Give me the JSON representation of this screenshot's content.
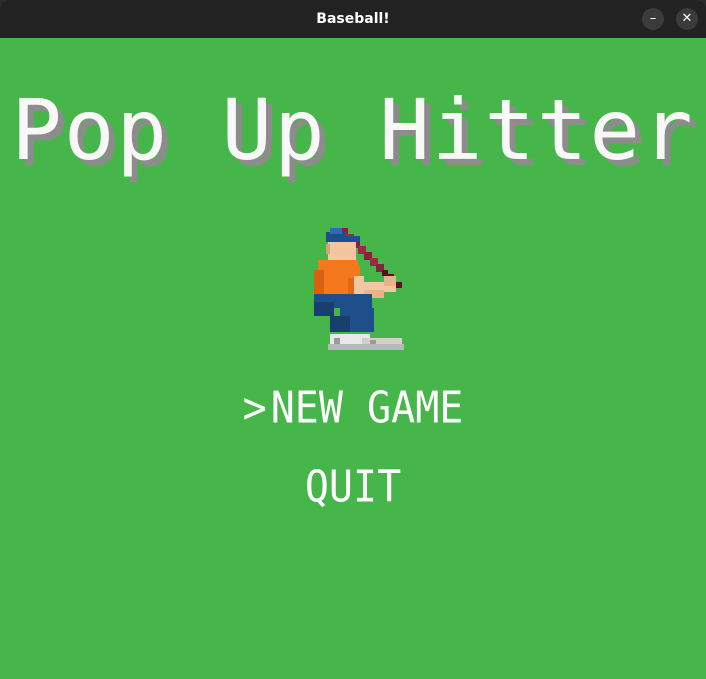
{
  "window": {
    "title": "Baseball!",
    "minimize_glyph": "–",
    "close_glyph": "✕"
  },
  "game": {
    "title": "Pop Up Hitter",
    "sprite": "baseball-batter",
    "menu": {
      "cursor": ">",
      "items": [
        {
          "label": "NEW GAME",
          "selected": true
        },
        {
          "label": "QUIT",
          "selected": false
        }
      ]
    }
  },
  "colors": {
    "background": "#47b64a",
    "title_fill": "#f8f8f8",
    "title_shadow": "#8c8c8c",
    "menu_text": "#ffffff",
    "titlebar": "#222222"
  }
}
